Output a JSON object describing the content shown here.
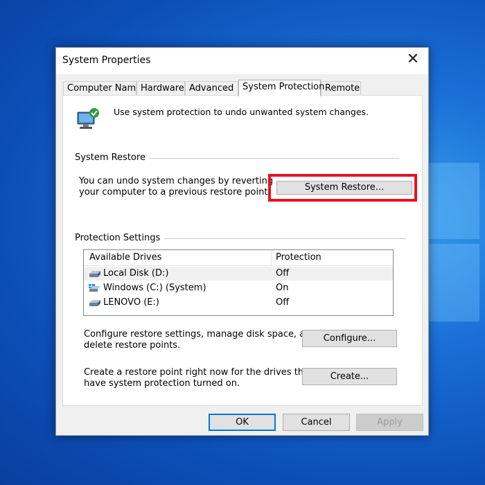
{
  "window": {
    "title": "System Properties",
    "close_glyph": "✕"
  },
  "tabs": [
    {
      "label": "Computer Name",
      "active": false
    },
    {
      "label": "Hardware",
      "active": false
    },
    {
      "label": "Advanced",
      "active": false
    },
    {
      "label": "System Protection",
      "active": true
    },
    {
      "label": "Remote",
      "active": false
    }
  ],
  "intro": {
    "text": "Use system protection to undo unwanted system changes.",
    "icon": "computer-shield-icon"
  },
  "system_restore": {
    "section_title": "System Restore",
    "description_line1": "You can undo system changes by reverting",
    "description_line2": "your computer to a previous restore point.",
    "button_label": "System Restore...",
    "highlight_color": "#e81123"
  },
  "protection_settings": {
    "section_title": "Protection Settings",
    "columns": [
      "Available Drives",
      "Protection"
    ],
    "drives": [
      {
        "name": "Local Disk (D:)",
        "protection": "Off",
        "icon": "drive-icon",
        "selected": true
      },
      {
        "name": "Windows (C:) (System)",
        "protection": "On",
        "icon": "windows-drive-icon",
        "selected": false
      },
      {
        "name": "LENOVO (E:)",
        "protection": "Off",
        "icon": "drive-icon",
        "selected": false
      }
    ],
    "configure_text_line1": "Configure restore settings, manage disk space, and",
    "configure_text_line2": "delete restore points.",
    "configure_button": "Configure...",
    "create_text_line1": "Create a restore point right now for the drives that",
    "create_text_line2": "have system protection turned on.",
    "create_button": "Create..."
  },
  "footer": {
    "ok": "OK",
    "cancel": "Cancel",
    "apply": "Apply"
  },
  "colors": {
    "accent": "#0078d7",
    "highlight": "#e81123"
  }
}
